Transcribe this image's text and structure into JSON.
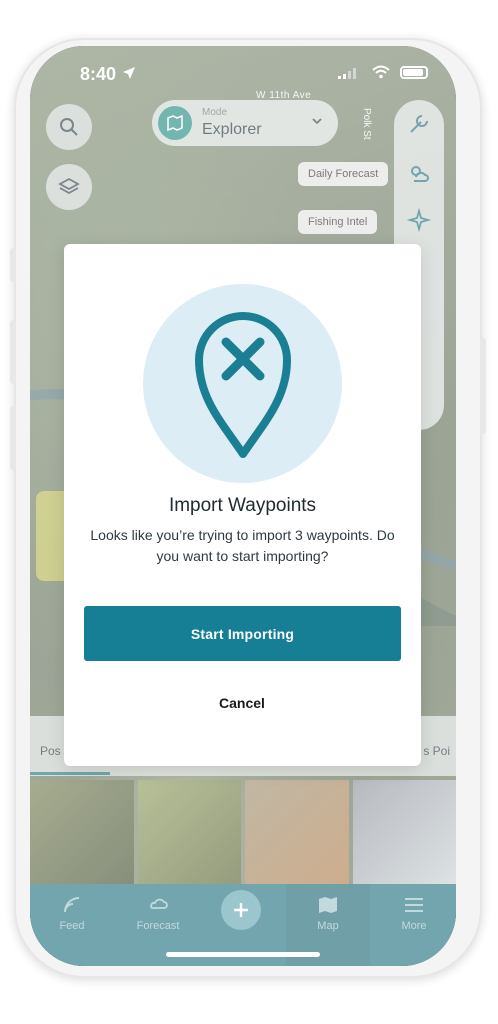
{
  "status_bar": {
    "time": "8:40"
  },
  "map": {
    "street_top": "W 11th Ave",
    "street_side": "Polk St",
    "mode_label": "Mode",
    "mode_value": "Explorer",
    "chips": [
      "Daily Forecast",
      "Fishing Intel"
    ]
  },
  "tabs": {
    "left": "Pos",
    "right": "s Poi"
  },
  "nav": {
    "items": [
      "Feed",
      "Forecast",
      "Map",
      "More"
    ]
  },
  "modal": {
    "title": "Import Waypoints",
    "message": "Looks like you’re trying to import 3 waypoints. Do you want to start importing?",
    "primary_button": "Start Importing",
    "cancel_button": "Cancel"
  },
  "colors": {
    "primary": "#177f95",
    "icon_bg": "#dcedf5",
    "icon_stroke": "#1a7f93",
    "nav_bg": "#1e6e7c"
  },
  "icons": [
    "search-icon",
    "layers-icon",
    "map-mode-icon",
    "chevron-down-icon",
    "tools-icon",
    "weather-icon",
    "sparkle-icon",
    "location-x-icon",
    "feed-icon",
    "forecast-icon",
    "plus-icon",
    "map-icon",
    "menu-icon"
  ]
}
